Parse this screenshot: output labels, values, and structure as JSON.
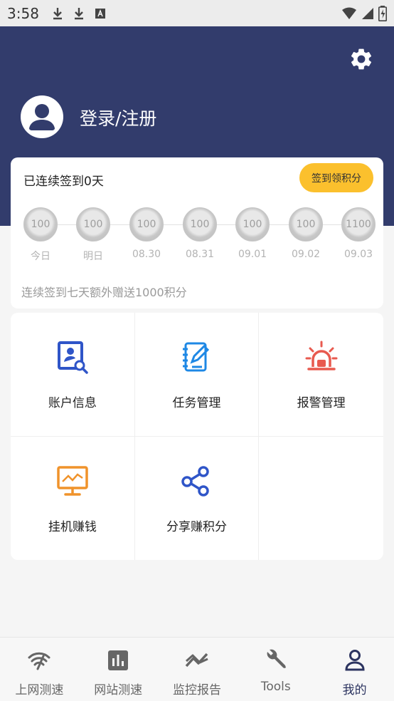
{
  "status_bar": {
    "time": "3:58"
  },
  "header": {
    "login_label": "登录/注册"
  },
  "signin": {
    "streak_text": "已连续签到0天",
    "button_label": "签到领积分",
    "days": [
      {
        "value": "100",
        "label": "今日"
      },
      {
        "value": "100",
        "label": "明日"
      },
      {
        "value": "100",
        "label": "08.30"
      },
      {
        "value": "100",
        "label": "08.31"
      },
      {
        "value": "100",
        "label": "09.01"
      },
      {
        "value": "100",
        "label": "09.02"
      },
      {
        "value": "1100",
        "label": "09.03"
      }
    ],
    "bonus_text": "连续签到七天额外赠送1000积分"
  },
  "menu": {
    "items": [
      {
        "label": "账户信息",
        "icon": "account-info-icon",
        "color": "#2f55c8"
      },
      {
        "label": "任务管理",
        "icon": "task-edit-icon",
        "color": "#1e88e5"
      },
      {
        "label": "报警管理",
        "icon": "alarm-siren-icon",
        "color": "#e85a4f"
      },
      {
        "label": "挂机赚钱",
        "icon": "monitor-chart-icon",
        "color": "#f0932b"
      },
      {
        "label": "分享赚积分",
        "icon": "share-icon",
        "color": "#2f55c8"
      }
    ]
  },
  "tabs": [
    {
      "label": "上网测速",
      "icon": "wifi-speed-icon"
    },
    {
      "label": "网站测速",
      "icon": "bar-chart-icon"
    },
    {
      "label": "监控报告",
      "icon": "trend-icon"
    },
    {
      "label": "Tools",
      "icon": "wrench-icon"
    },
    {
      "label": "我的",
      "icon": "user-icon",
      "active": true
    }
  ],
  "colors": {
    "header": "#323c6c",
    "accent": "#fbc02d"
  }
}
